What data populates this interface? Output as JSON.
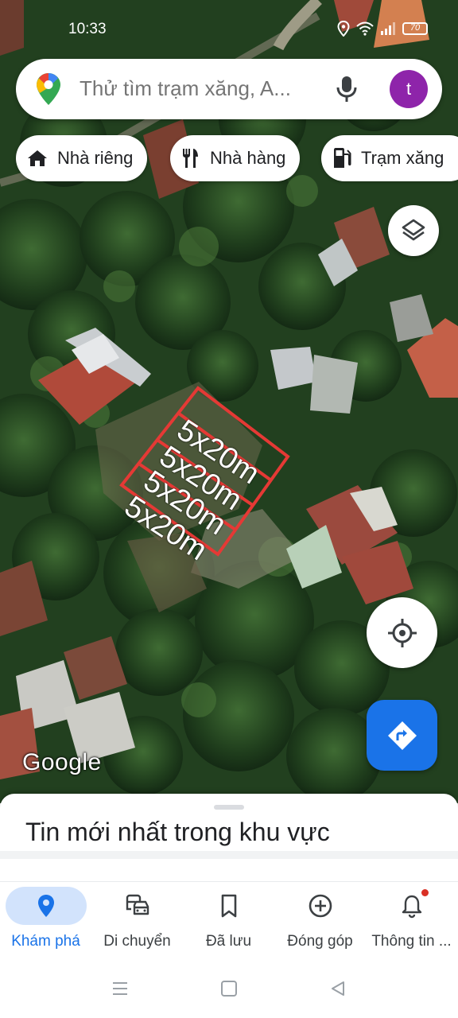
{
  "status_bar": {
    "time": "10:33",
    "battery": "70"
  },
  "search": {
    "placeholder": "Thử tìm trạm xăng, A...",
    "avatar_letter": "t"
  },
  "chips": [
    {
      "label": "Nhà riêng",
      "icon": "home-icon"
    },
    {
      "label": "Nhà hàng",
      "icon": "restaurant-icon"
    },
    {
      "label": "Trạm xăng",
      "icon": "gas-station-icon"
    }
  ],
  "map": {
    "plot_labels": [
      "5x20m",
      "5x20m",
      "5x20m",
      "5x20m"
    ],
    "watermark": "Google",
    "plot_border_color": "#e53935"
  },
  "sheet": {
    "title": "Tin mới nhất trong khu vực"
  },
  "bottom_nav": [
    {
      "label": "Khám phá",
      "icon": "explore-pin-icon",
      "active": true
    },
    {
      "label": "Di chuyển",
      "icon": "commute-icon",
      "active": false
    },
    {
      "label": "Đã lưu",
      "icon": "bookmark-icon",
      "active": false
    },
    {
      "label": "Đóng góp",
      "icon": "add-circle-icon",
      "active": false
    },
    {
      "label": "Thông tin ...",
      "icon": "notifications-icon",
      "active": false,
      "badge": true
    }
  ],
  "colors": {
    "accent": "#1a73e8",
    "avatar": "#8e24aa",
    "active_pill": "#d2e3fc"
  }
}
